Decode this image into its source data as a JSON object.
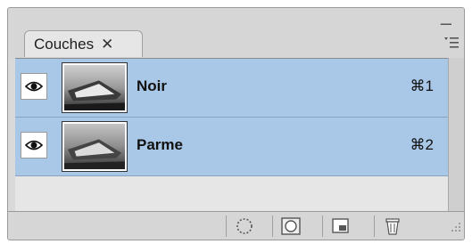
{
  "panel": {
    "tab_label": "Couches",
    "close_glyph": "✕",
    "minimize_glyph": "–"
  },
  "layers": [
    {
      "name": "Noir",
      "shortcut": "⌘1",
      "visible": true,
      "selected": true
    },
    {
      "name": "Parme",
      "shortcut": "⌘2",
      "visible": true,
      "selected": true
    }
  ],
  "bottom_toolbar": {
    "icons": [
      "dotted-circle-icon",
      "mask-icon",
      "new-channel-icon",
      "trash-icon"
    ]
  },
  "colors": {
    "selection": "#a9c7e6",
    "panel_bg": "#d9d9d9"
  }
}
